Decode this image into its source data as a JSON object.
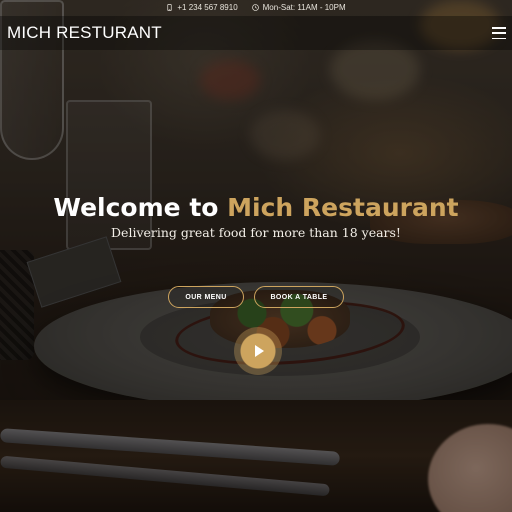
{
  "topbar": {
    "phone": "+1 234 567 8910",
    "hours": "Mon-Sat: 11AM - 10PM",
    "phone_icon": "phone-icon",
    "clock_icon": "clock-icon"
  },
  "header": {
    "logo": "MICH RESTURANT",
    "menu_icon": "hamburger-menu-icon"
  },
  "hero": {
    "title_prefix": "Welcome to ",
    "title_accent": "Mich Restaurant",
    "subtitle": "Delivering great food for more than 18 years!",
    "buttons": {
      "menu": "OUR MENU",
      "book": "BOOK A TABLE"
    },
    "play_icon": "play-icon"
  },
  "colors": {
    "accent": "#cda45e",
    "text": "#ffffff"
  }
}
